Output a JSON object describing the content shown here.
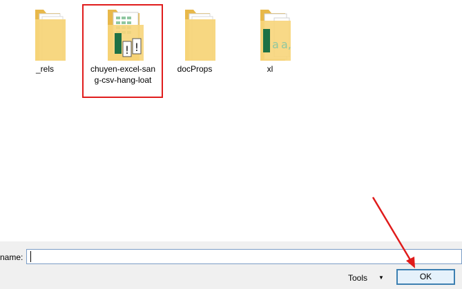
{
  "files": [
    {
      "name": "_rels",
      "icon": "folder-icon"
    },
    {
      "name": "chuyen-excel-sang-csv-hang-loat",
      "icon": "folder-excel-icon"
    },
    {
      "name": "docProps",
      "icon": "folder-icon"
    },
    {
      "name": "xl",
      "icon": "folder-excel-icon"
    }
  ],
  "footer": {
    "filename_label": "name:",
    "filename_value": "",
    "tools_label": "Tools",
    "ok_label": "OK"
  },
  "colors": {
    "highlight": "#e01b1b",
    "folder": "#f5cf6a",
    "excel_green": "#1e7145",
    "button_border": "#3c7fb1"
  }
}
